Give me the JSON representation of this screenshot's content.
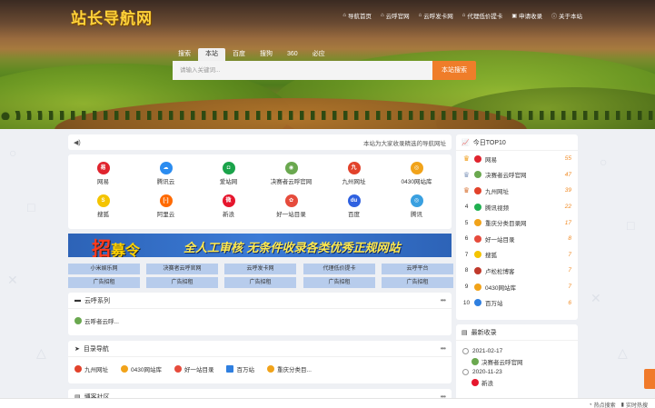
{
  "header": {
    "logo": "站长导航网",
    "nav": [
      {
        "icon": "home-icon",
        "label": "导航首页"
      },
      {
        "icon": "home-icon",
        "label": "云呼官网"
      },
      {
        "icon": "home-icon",
        "label": "云呼发卡网"
      },
      {
        "icon": "home-icon",
        "label": "代理低价提卡"
      },
      {
        "icon": "plus-square-icon",
        "label": "申请收录"
      },
      {
        "icon": "info-circle-icon",
        "label": "关于本站"
      }
    ]
  },
  "search": {
    "tabs": [
      "搜索",
      "本站",
      "百度",
      "搜狗",
      "360",
      "必应"
    ],
    "active_tab": "本站",
    "placeholder": "请输入关键词...",
    "button": "本站搜索"
  },
  "notice": {
    "text": "本站为大家收录精选的导航网址"
  },
  "quick_links": [
    {
      "label": "网易",
      "icon": "netease-icon",
      "color": "#e0242e",
      "glyph": "易"
    },
    {
      "label": "腾讯云",
      "icon": "cloud-icon",
      "color": "#2b8cf0",
      "glyph": "☁"
    },
    {
      "label": "爱站网",
      "icon": "aizhan-icon",
      "color": "#1aa34a",
      "glyph": "◘"
    },
    {
      "label": "决赛者云呼官网",
      "icon": "globe-icon",
      "color": "#6aa84f",
      "glyph": "◉"
    },
    {
      "label": "九州网址",
      "icon": "jiuzhou-icon",
      "color": "#e2422b",
      "glyph": "九"
    },
    {
      "label": "0430网站库",
      "icon": "chrome-icon",
      "color": "#f1a31a",
      "glyph": "◎"
    },
    {
      "label": "搜狐",
      "icon": "sohu-icon",
      "color": "#f4c400",
      "glyph": "S"
    },
    {
      "label": "阿里云",
      "icon": "aliyun-icon",
      "color": "#ff6a00",
      "glyph": "[-]"
    },
    {
      "label": "新浪",
      "icon": "weibo-icon",
      "color": "#e6162d",
      "glyph": "微"
    },
    {
      "label": "好一站目录",
      "icon": "pinwheel-icon",
      "color": "#e64b3c",
      "glyph": "✿"
    },
    {
      "label": "百度",
      "icon": "baidu-paw-icon",
      "color": "#2f61e0",
      "glyph": "du"
    },
    {
      "label": "腾讯",
      "icon": "qq-icon",
      "color": "#3aa0e0",
      "glyph": "◎"
    }
  ],
  "banner": {
    "zhao": "招",
    "mu_ling": "募令",
    "text": "全人工审核  无条件收录各类优秀正规网站"
  },
  "ads": [
    "小米娱乐网",
    "决赛者云呼官网",
    "云呼发卡网",
    "代理低价提卡",
    "云呼平台",
    "广告招租",
    "广告招租",
    "广告招租",
    "广告招租",
    "广告招租"
  ],
  "sections": [
    {
      "title": "云呼系列",
      "icon": "chat-icon",
      "links": [
        {
          "label": "云呼者云呼...",
          "icon": "globe-icon",
          "color": "#6aa84f"
        }
      ]
    },
    {
      "title": "目录导航",
      "icon": "send-icon",
      "links": [
        {
          "label": "九州网址",
          "icon": "jiuzhou-icon",
          "color": "#e2422b"
        },
        {
          "label": "0430网站库",
          "icon": "chrome-icon",
          "color": "#f1a31a"
        },
        {
          "label": "好一站目录",
          "icon": "pinwheel-icon",
          "color": "#e64b3c"
        },
        {
          "label": "百万站",
          "icon": "bwz-icon",
          "color": "#2f7fe0"
        },
        {
          "label": "重庆分类目...",
          "icon": "chrome-icon",
          "color": "#f1a31a"
        }
      ]
    },
    {
      "title": "博客社区",
      "icon": "book-icon",
      "links": []
    }
  ],
  "more_label": "•••",
  "top10": {
    "title": "今日TOP10",
    "items": [
      {
        "rank": "1",
        "name": "网易",
        "count": "55",
        "color": "#e0242e"
      },
      {
        "rank": "2",
        "name": "决赛者云呼官网",
        "count": "47",
        "color": "#6aa84f"
      },
      {
        "rank": "3",
        "name": "九州网址",
        "count": "39",
        "color": "#e2422b"
      },
      {
        "rank": "4",
        "name": "腾讯视频",
        "count": "22",
        "color": "#20b050"
      },
      {
        "rank": "5",
        "name": "重庆分类目录网",
        "count": "17",
        "color": "#f1a31a"
      },
      {
        "rank": "6",
        "name": "好一站目录",
        "count": "8",
        "color": "#e64b3c"
      },
      {
        "rank": "7",
        "name": "搜狐",
        "count": "7",
        "color": "#f4c400"
      },
      {
        "rank": "8",
        "name": "卢松松博客",
        "count": "7",
        "color": "#c0392b"
      },
      {
        "rank": "9",
        "name": "0430网站库",
        "count": "7",
        "color": "#f1a31a"
      },
      {
        "rank": "10",
        "name": "百万站",
        "count": "6",
        "color": "#2f7fe0"
      }
    ]
  },
  "latest": {
    "title": "最新收录",
    "entries": [
      {
        "date": "2021-02-17",
        "name": "决赛者云呼官网",
        "color": "#6aa84f"
      },
      {
        "date": "2020-11-23",
        "name": "新浪",
        "color": "#e6162d"
      }
    ]
  },
  "footer": {
    "links": [
      "热点搜索",
      "实时热搜"
    ]
  }
}
